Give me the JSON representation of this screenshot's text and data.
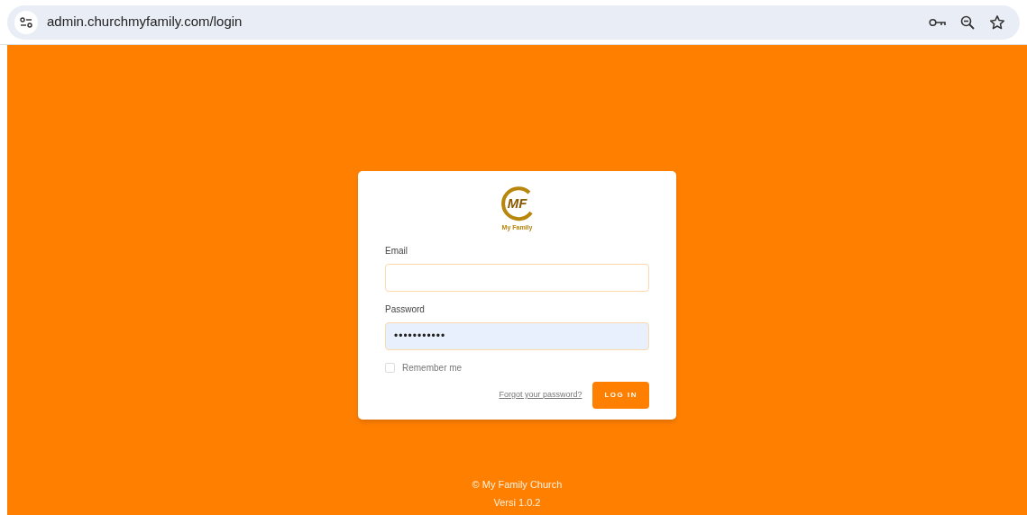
{
  "browser": {
    "url": "admin.churchmyfamily.com/login"
  },
  "login": {
    "logo": {
      "mark": "MF",
      "name": "My Family"
    },
    "email": {
      "label": "Email",
      "autofilled": false
    },
    "password": {
      "label": "Password",
      "value": "•••••••••••",
      "autofilled": true
    },
    "remember": {
      "label": "Remember me",
      "checked": false
    },
    "forgot_link": "Forgot your password?",
    "submit": "LOG IN"
  },
  "footer": [
    "© My Family Church",
    "Versi 1.0.2"
  ]
}
